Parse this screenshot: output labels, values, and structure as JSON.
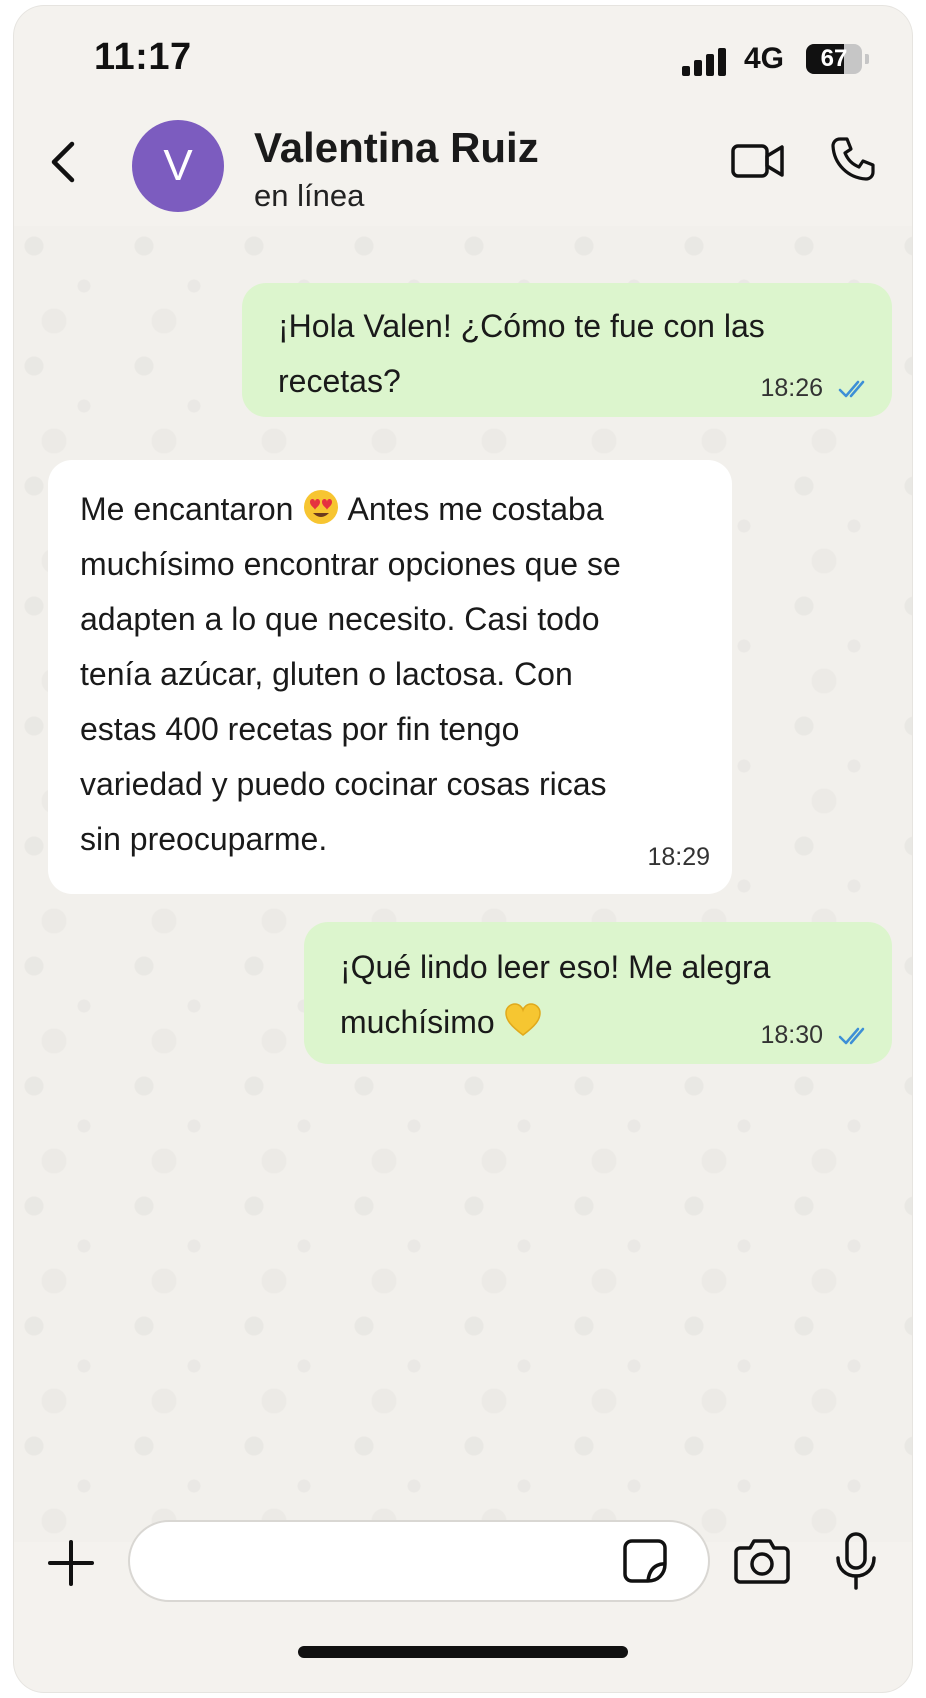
{
  "status_bar": {
    "time": "11:17",
    "network": "4G",
    "battery": "67",
    "battery_level_percent": 67
  },
  "header": {
    "avatar_initial": "V",
    "contact_name": "Valentina Ruiz",
    "contact_status": "en línea",
    "icons": [
      "back-icon",
      "video-camera-icon",
      "phone-icon"
    ]
  },
  "messages": [
    {
      "direction": "outgoing",
      "lines": [
        "¡Hola Valen! ¿Cómo te fue con las",
        "recetas?"
      ],
      "time": "18:26",
      "read": true
    },
    {
      "direction": "incoming",
      "lines": [
        "Me encantaron",
        "Antes me costaba",
        "muchísimo encontrar opciones que se",
        "adapten a lo que necesito. Casi todo",
        "tenía azúcar, gluten o lactosa. Con",
        "estas 400 recetas por fin tengo",
        "variedad y puedo cocinar cosas ricas",
        "sin preocuparme."
      ],
      "emoji": "heart-eyes-emoji",
      "time": "18:29"
    },
    {
      "direction": "outgoing",
      "lines": [
        "¡Qué lindo leer eso! Me alegra",
        "muchísimo"
      ],
      "emoji": "yellow-heart-emoji",
      "time": "18:30",
      "read": true
    }
  ],
  "composer": {
    "input_value": "",
    "icons": [
      "plus-icon",
      "sticker-icon",
      "camera-icon",
      "microphone-icon"
    ]
  },
  "colors": {
    "outgoing_bubble": "#dcf5cd",
    "incoming_bubble": "#ffffff",
    "avatar": "#7c5cbf",
    "read_ticks": "#3d8fd6"
  }
}
